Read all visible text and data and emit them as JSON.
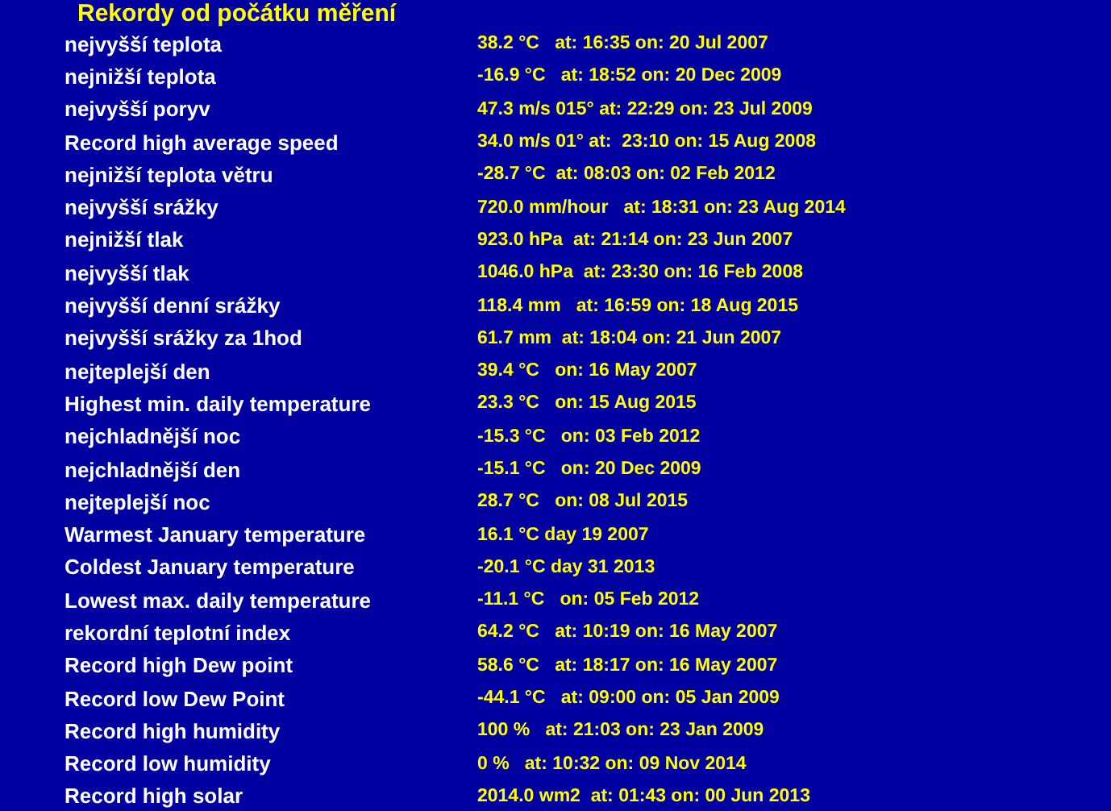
{
  "title": "Rekordy od počátku měření",
  "records": [
    {
      "label": "nejvyšší teplota",
      "value": "38.2 °C   at: 16:35 on: 20 Jul 2007"
    },
    {
      "label": "nejnižší teplota",
      "value": "-16.9 °C   at: 18:52 on: 20 Dec 2009"
    },
    {
      "label": "nejvyšší poryv",
      "value": "47.3 m/s 015° at: 22:29 on: 23 Jul 2009"
    },
    {
      "label": "Record high average speed",
      "value": "34.0 m/s 01° at:  23:10 on: 15 Aug 2008"
    },
    {
      "label": "nejnižší teplota větru",
      "value": "-28.7 °C  at: 08:03 on: 02 Feb 2012"
    },
    {
      "label": "nejvyšší srážky",
      "value": "720.0 mm/hour   at: 18:31 on: 23 Aug 2014"
    },
    {
      "label": "nejnižší tlak",
      "value": "923.0 hPa  at: 21:14 on: 23 Jun 2007"
    },
    {
      "label": "nejvyšší tlak",
      "value": "1046.0 hPa  at: 23:30 on: 16 Feb 2008"
    },
    {
      "label": "nejvyšší denní srážky",
      "value": "118.4 mm   at: 16:59 on: 18 Aug 2015"
    },
    {
      "label": "nejvyšší srážky za 1hod",
      "value": "61.7 mm  at: 18:04 on: 21 Jun 2007"
    },
    {
      "label": "nejteplejší den",
      "value": "39.4 °C   on: 16 May 2007"
    },
    {
      "label": "Highest min. daily temperature",
      "value": "23.3 °C   on: 15 Aug 2015"
    },
    {
      "label": "nejchladnější noc",
      "value": "-15.3 °C   on: 03 Feb 2012"
    },
    {
      "label": "nejchladnější den",
      "value": "-15.1 °C   on: 20 Dec 2009"
    },
    {
      "label": "nejteplejší noc",
      "value": "28.7 °C   on: 08 Jul 2015"
    },
    {
      "label": "Warmest January temperature",
      "value": "16.1 °C day 19 2007"
    },
    {
      "label": "Coldest January temperature",
      "value": "-20.1 °C day 31 2013"
    },
    {
      "label": "Lowest max. daily temperature",
      "value": "-11.1 °C   on: 05 Feb 2012"
    },
    {
      "label": "rekordní teplotní index",
      "value": "64.2 °C   at: 10:19 on: 16 May 2007"
    },
    {
      "label": "Record high Dew point",
      "value": "58.6 °C   at: 18:17 on: 16 May 2007"
    },
    {
      "label": "Record low Dew Point",
      "value": "-44.1 °C   at: 09:00 on: 05 Jan 2009"
    },
    {
      "label": "Record high humidity",
      "value": "100 %   at: 21:03 on: 23 Jan 2009"
    },
    {
      "label": "Record low humidity",
      "value": "0 %   at: 10:32 on: 09 Nov 2014"
    },
    {
      "label": "Record high solar",
      "value": "2014.0 wm2  at: 01:43 on: 00 Jun 2013"
    }
  ]
}
